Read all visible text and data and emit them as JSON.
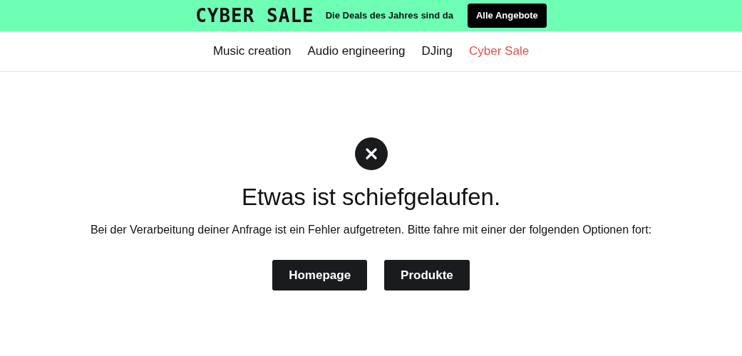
{
  "promo_banner": {
    "logo": "CYBER SALE",
    "tagline": "Die Deals des Jahres sind da",
    "button": "Alle Angebote"
  },
  "nav": {
    "items": [
      {
        "label": "Music creation",
        "kind": "regular"
      },
      {
        "label": "Audio engineering",
        "kind": "regular"
      },
      {
        "label": "DJing",
        "kind": "regular"
      },
      {
        "label": "Cyber Sale",
        "kind": "sale"
      }
    ]
  },
  "error": {
    "title": "Etwas ist schiefgelaufen.",
    "message": "Bei der Verarbeitung deiner Anfrage ist ein Fehler aufgetreten. Bitte fahre mit einer der folgenden Optionen fort:",
    "buttons": [
      "Homepage",
      "Produkte"
    ]
  }
}
